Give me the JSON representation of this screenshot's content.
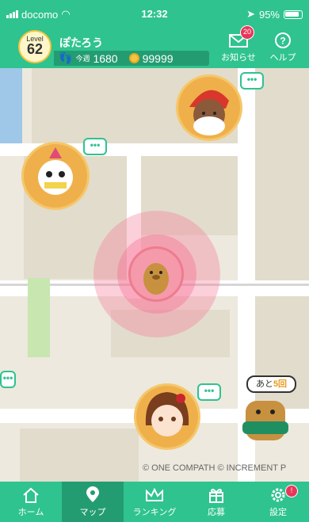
{
  "status_bar": {
    "carrier": "docomo",
    "time": "12:32",
    "battery": "95%"
  },
  "header": {
    "level_label": "Level",
    "level_value": "62",
    "username": "ぽたろう",
    "weekly_label": "今週",
    "weekly_steps": "1680",
    "coins": "99999",
    "notice_label": "お知らせ",
    "notice_badge": "20",
    "help_label": "ヘルプ",
    "help_icon": "question-circle-icon",
    "notice_icon": "envelope-icon"
  },
  "map": {
    "copyright": "© ONE COMPATH © INCREMENT P",
    "bubble_text": "•••",
    "ato_prefix": "あと",
    "ato_count": "5回",
    "colors": {
      "accent": "#2fc38f",
      "accent_dark": "#249c72",
      "badge": "#e8365b",
      "pulse": "#f49aaa"
    }
  },
  "tabs": [
    {
      "label": "ホーム",
      "icon": "home-icon",
      "active": false
    },
    {
      "label": "マップ",
      "icon": "map-pin-icon",
      "active": true
    },
    {
      "label": "ランキング",
      "icon": "crown-icon",
      "active": false
    },
    {
      "label": "応募",
      "icon": "gift-icon",
      "active": false
    },
    {
      "label": "設定",
      "icon": "gear-icon",
      "active": false,
      "badge": "!"
    }
  ]
}
